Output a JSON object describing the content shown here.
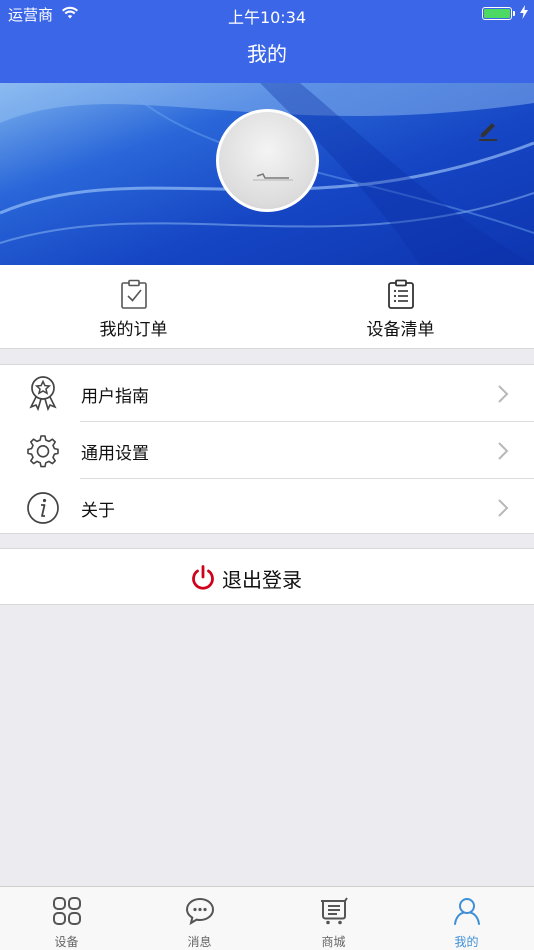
{
  "status_bar": {
    "carrier": "运营商",
    "time": "上午10:34",
    "battery_level": 1.0,
    "charging": true
  },
  "nav": {
    "title": "我的"
  },
  "profile": {
    "avatar_icon": "avatar-photo",
    "edit_icon": "edit-pencil-icon"
  },
  "quick_actions": [
    {
      "label": "我的订单",
      "icon": "clipboard-check-icon"
    },
    {
      "label": "设备清单",
      "icon": "clipboard-list-icon"
    }
  ],
  "menu": [
    {
      "label": "用户指南",
      "icon": "award-ribbon-icon"
    },
    {
      "label": "通用设置",
      "icon": "gear-icon"
    },
    {
      "label": "关于",
      "icon": "info-icon"
    }
  ],
  "logout": {
    "label": "退出登录",
    "icon": "power-icon",
    "color": "#d0021b"
  },
  "tabs": [
    {
      "label": "设备",
      "icon": "grid-icon",
      "active": false
    },
    {
      "label": "消息",
      "icon": "chat-bubble-icon",
      "active": false
    },
    {
      "label": "商城",
      "icon": "cart-icon",
      "active": false
    },
    {
      "label": "我的",
      "icon": "person-icon",
      "active": true
    }
  ],
  "colors": {
    "primary": "#3b66e8",
    "tab_active": "#3f8fd6",
    "background": "#ebebf0"
  }
}
